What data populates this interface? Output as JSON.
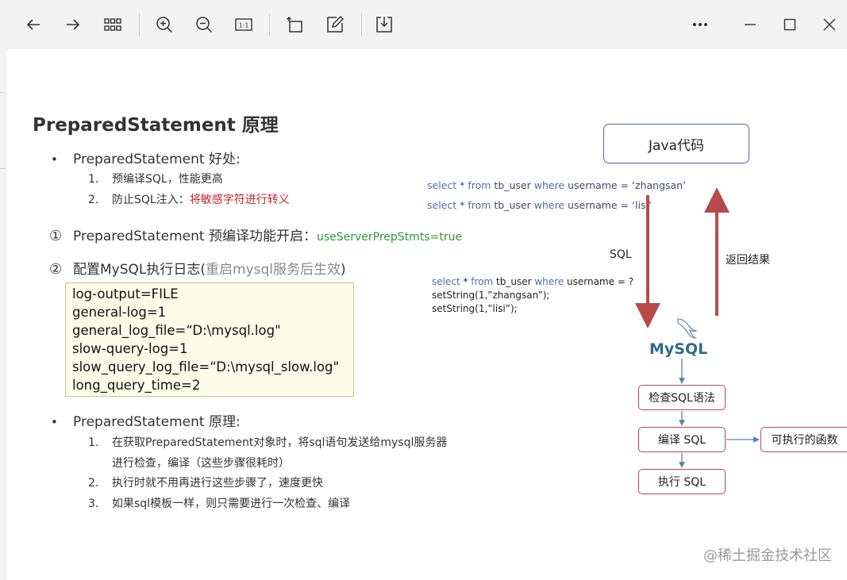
{
  "toolbar": {
    "buttons": [
      {
        "name": "back-arrow-icon"
      },
      {
        "name": "forward-arrow-icon"
      },
      {
        "name": "grid-view-icon"
      },
      {
        "name": "zoom-in-icon"
      },
      {
        "name": "zoom-out-icon"
      },
      {
        "name": "actual-size-icon",
        "label": "1:1"
      },
      {
        "name": "rotate-icon"
      },
      {
        "name": "edit-icon"
      },
      {
        "name": "save-download-icon"
      }
    ],
    "window_controls": [
      "more-options-icon",
      "minimize-icon",
      "maximize-icon",
      "close-icon"
    ]
  },
  "slide": {
    "title": "PreparedStatement 原理",
    "benefits": {
      "heading": "PreparedStatement 好处:",
      "items": [
        {
          "num": "1.",
          "text": "预编译SQL，性能更高",
          "highlight": ""
        },
        {
          "num": "2.",
          "text": "防止SQL注入：",
          "highlight": "将敏感字符进行转义"
        }
      ]
    },
    "step1": {
      "marker": "①",
      "text": "PreparedStatement 预编译功能开启：",
      "param": "useServerPrepStmts=true"
    },
    "step2": {
      "marker": "②",
      "text": "配置MySQL执行日志(",
      "note": "重启mysql服务后生效",
      "close": ")"
    },
    "log_config": [
      "log-output=FILE",
      "general-log=1",
      "general_log_file=“D:\\mysql.log\"",
      "slow-query-log=1",
      "slow_query_log_file=“D:\\mysql_slow.log\"",
      "long_query_time=2"
    ],
    "principle": {
      "heading": "PreparedStatement 原理:",
      "items": [
        {
          "num": "1.",
          "line1": "在获取PreparedStatement对象时，将sql语句发送给mysql服务器",
          "line2": "进行检查，编译（这些步骤很耗时）"
        },
        {
          "num": "2.",
          "line1": "执行时就不用再进行这些步骤了，速度更快",
          "line2": ""
        },
        {
          "num": "3.",
          "line1": "如果sql模板一样，则只需要进行一次检查、编译",
          "line2": ""
        }
      ]
    }
  },
  "diagram": {
    "java_box": "Java代码",
    "sql_examples": [
      {
        "kw1": "select",
        "star": " * ",
        "kw2": "from",
        "mid": " tb_user ",
        "kw3": "where",
        "rest": " username = ‘zhangsan’"
      },
      {
        "kw1": "select",
        "star": " * ",
        "kw2": "from",
        "mid": " tb_user ",
        "kw3": "where",
        "rest": " username = ‘lisi’"
      }
    ],
    "arrow_down_label": "SQL",
    "arrow_up_label": "返回结果",
    "prepared_sql": {
      "kw1": "select",
      "star": " * ",
      "kw2": "from",
      "mid": " tb_user ",
      "kw3": "where",
      "rest": " username = ?",
      "set1": "setString(1,”zhangsan”);",
      "set2": "setString(1,”lisi”);"
    },
    "mysql_logo": "MySQL",
    "steps": [
      "检查SQL语法",
      "编译 SQL",
      "执行 SQL"
    ],
    "result_box": "可执行的函数",
    "colors": {
      "java_border": "#4a6b9c",
      "arrow_red": "#b94a4a",
      "step_border": "#b74b4b",
      "connector": "#5a7fb0"
    }
  },
  "watermark": "@稀土掘金技术社区"
}
